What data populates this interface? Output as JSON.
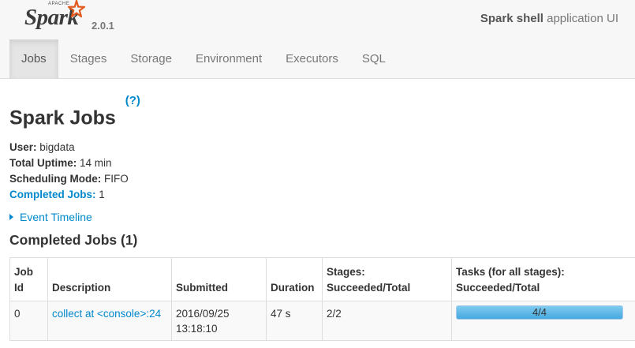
{
  "brand": {
    "apache": "APACHE",
    "spark": "Spark",
    "version": "2.0.1",
    "star_color": "#e25a1c"
  },
  "header": {
    "app_name": "Spark shell",
    "app_suffix": "application UI"
  },
  "nav": {
    "tabs": [
      {
        "label": "Jobs",
        "active": true
      },
      {
        "label": "Stages",
        "active": false
      },
      {
        "label": "Storage",
        "active": false
      },
      {
        "label": "Environment",
        "active": false
      },
      {
        "label": "Executors",
        "active": false
      },
      {
        "label": "SQL",
        "active": false
      }
    ]
  },
  "page": {
    "title": "Spark Jobs",
    "help": "(?)"
  },
  "summary": {
    "user_label": "User:",
    "user_value": "bigdata",
    "uptime_label": "Total Uptime:",
    "uptime_value": "14 min",
    "mode_label": "Scheduling Mode:",
    "mode_value": "FIFO",
    "completed_label": "Completed Jobs:",
    "completed_value": "1"
  },
  "timeline": {
    "label": "Event Timeline"
  },
  "completed": {
    "title": "Completed Jobs (1)",
    "headers": {
      "job_id": "Job Id",
      "description": "Description",
      "submitted": "Submitted",
      "duration": "Duration",
      "stages": "Stages: Succeeded/Total",
      "tasks": "Tasks (for all stages): Succeeded/Total"
    },
    "rows": [
      {
        "job_id": "0",
        "description": "collect at <console>:24",
        "submitted": "2016/09/25 13:18:10",
        "duration": "47 s",
        "stages": "2/2",
        "tasks": "4/4",
        "tasks_fraction": 1.0
      }
    ]
  },
  "colors": {
    "link": "#0088cc",
    "progress": "#5bb8ea"
  }
}
